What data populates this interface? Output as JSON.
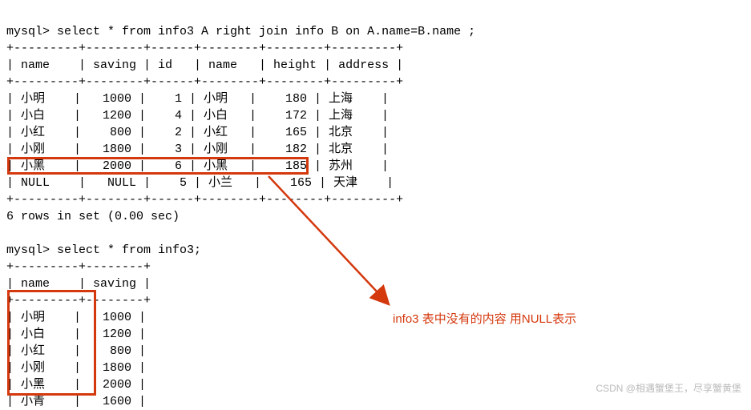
{
  "query1": {
    "prompt": "mysql> ",
    "sql": "select * from info3 A right join info B on A.name=B.name ;",
    "sep_top": "+---------+--------+------+--------+--------+---------+",
    "header": "| name    | saving | id   | name   | height | address |",
    "sep_mid": "+---------+--------+------+--------+--------+---------+",
    "rows": [
      "| 小明    |   1000 |    1 | 小明   |    180 | 上海    |",
      "| 小白    |   1200 |    4 | 小白   |    172 | 上海    |",
      "| 小红    |    800 |    2 | 小红   |    165 | 北京    |",
      "| 小刚    |   1800 |    3 | 小刚   |    182 | 北京    |",
      "| 小黑    |   2000 |    6 | 小黑   |    185 | 苏州    |",
      "| NULL    |   NULL |    5 | 小兰   |    165 | 天津    |"
    ],
    "sep_bot": "+---------+--------+------+--------+--------+---------+",
    "status": "6 rows in set (0.00 sec)"
  },
  "query2": {
    "prompt": "mysql> ",
    "sql": "select * from info3;",
    "sep_top": "+---------+--------+",
    "header": "| name    | saving |",
    "sep_mid": "+---------+--------+",
    "rows": [
      "| 小明    |   1000 |",
      "| 小白    |   1200 |",
      "| 小红    |    800 |",
      "| 小刚    |   1800 |",
      "| 小黑    |   2000 |",
      "| 小青    |   1600 |"
    ]
  },
  "annotation": "info3 表中没有的内容  用NULL表示",
  "watermark": "CSDN @相遇蟹堡王，尽享蟹黄堡"
}
